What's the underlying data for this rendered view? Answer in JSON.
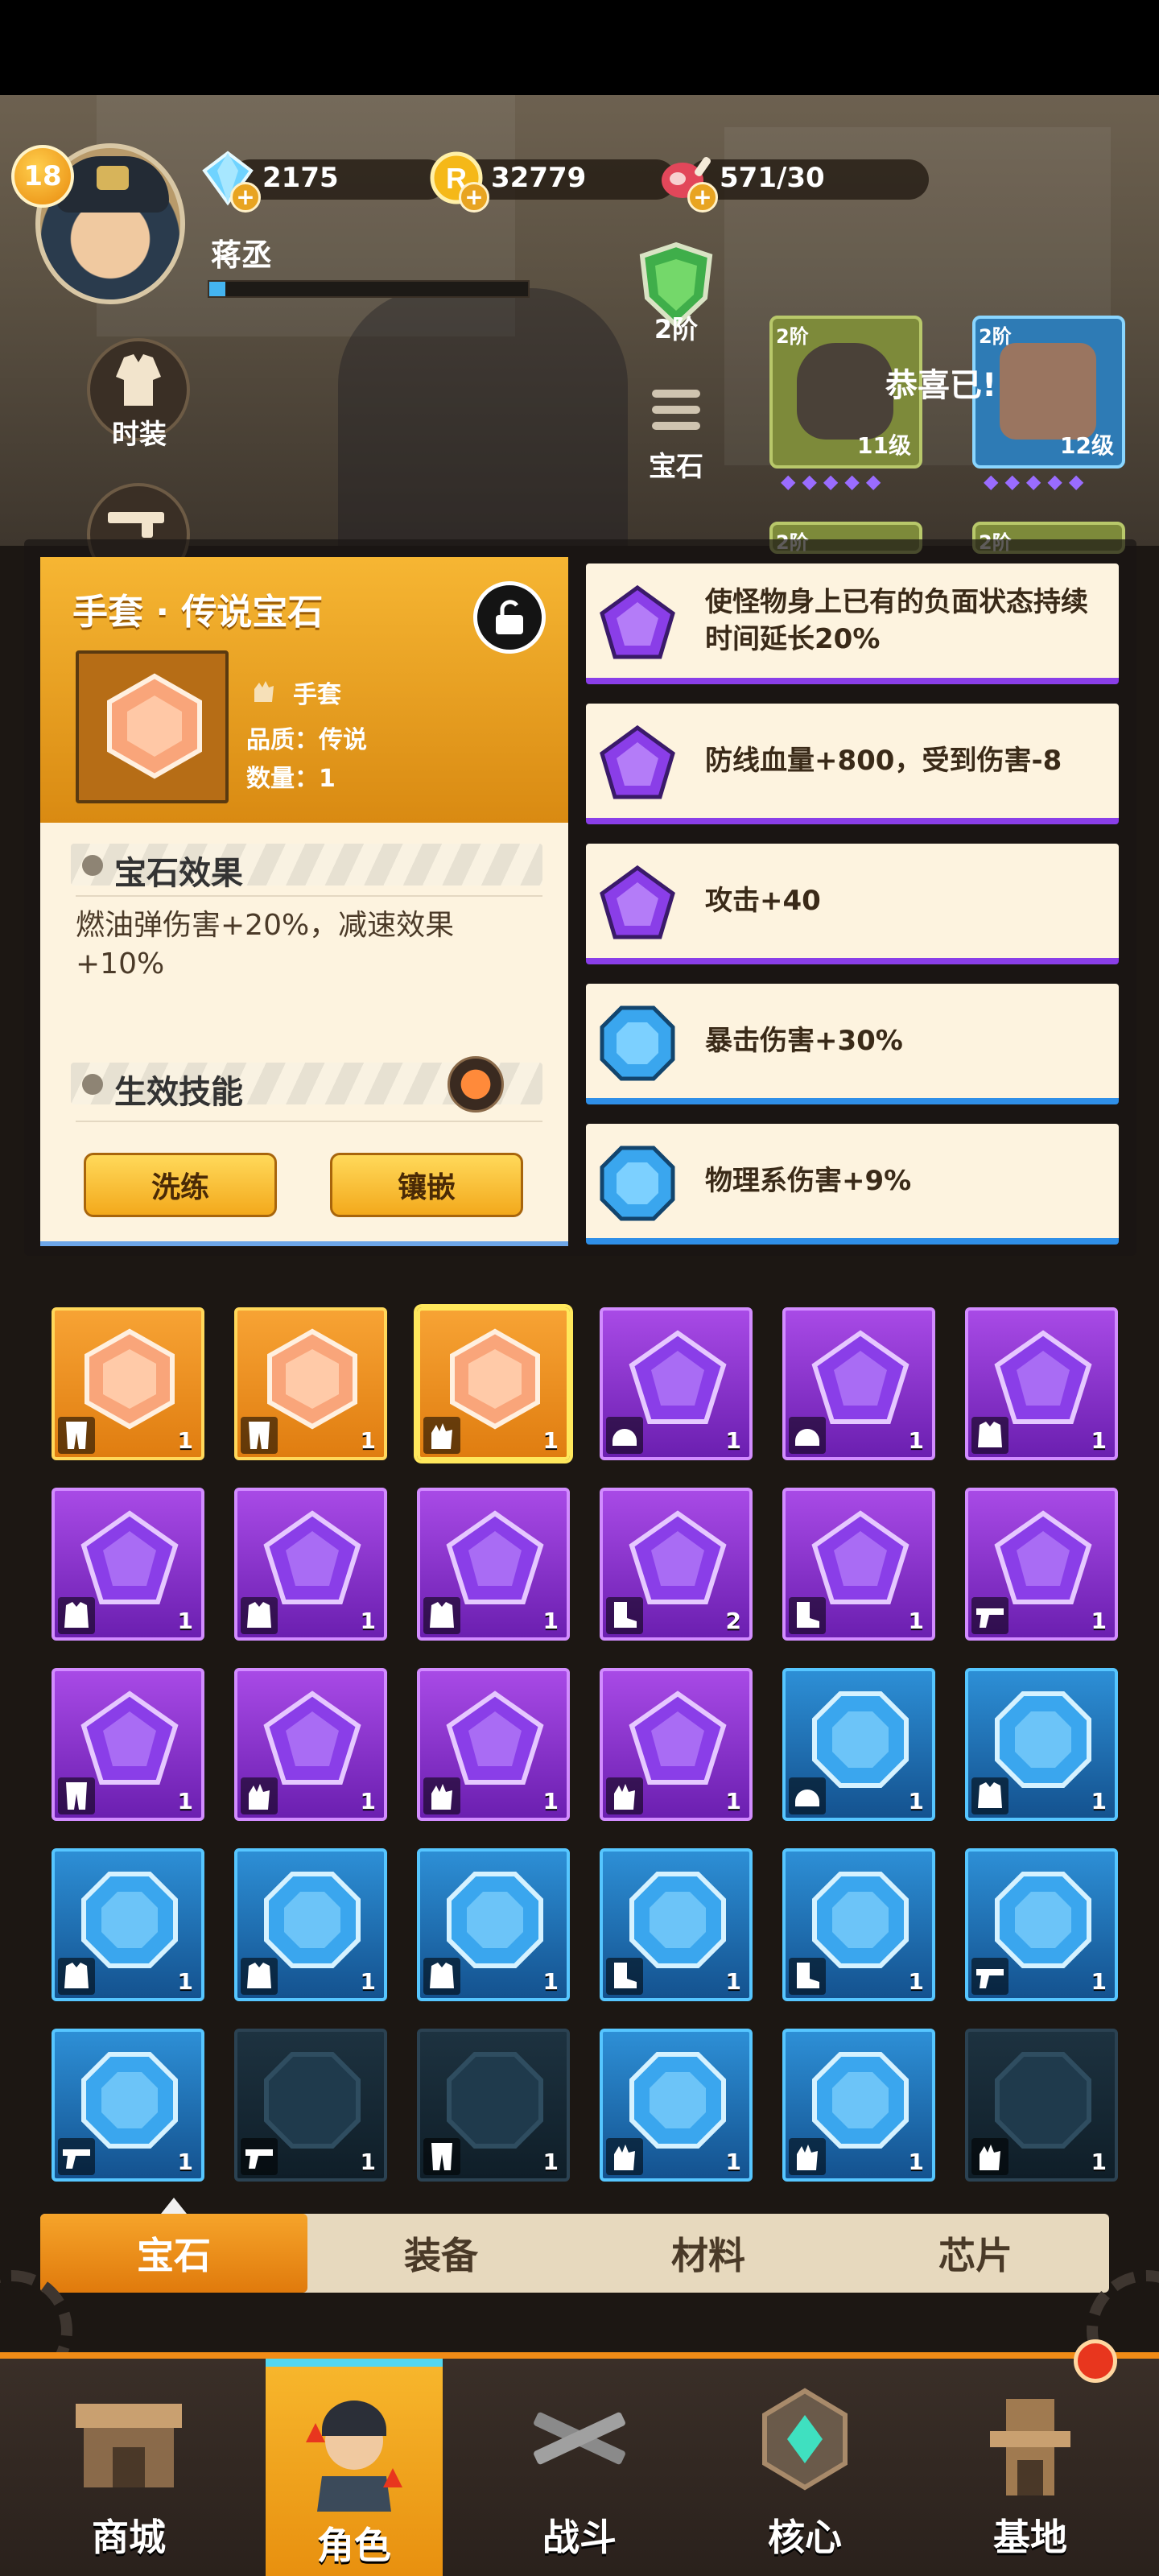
{
  "player": {
    "level": "18",
    "name": "蒋丞",
    "exp_fraction": 0.05
  },
  "resources": [
    {
      "name": "diamond",
      "value": "2175",
      "icon": "diamond-icon"
    },
    {
      "name": "coin",
      "value": "32779",
      "icon": "r-coin-icon"
    },
    {
      "name": "stamina",
      "value": "571/30",
      "icon": "meat-icon"
    }
  ],
  "side_buttons": {
    "fashion": "时装"
  },
  "equip_panel": {
    "tier_label": "2阶",
    "gem_label": "宝石",
    "congrats": "恭喜已!",
    "cards": [
      {
        "tier": "2阶",
        "level": "11级"
      },
      {
        "tier": "2阶",
        "level": "12级"
      },
      {
        "tier": "2阶"
      },
      {
        "tier": "2阶"
      }
    ]
  },
  "detail": {
    "title": "手套 · 传说宝石",
    "slot": "手套",
    "quality": "品质：传说",
    "quantity": "数量：1",
    "effect_header": "宝石效果",
    "effect_text": "燃油弹伤害+20%，减速效果+10%",
    "skill_header": "生效技能",
    "refine_button": "洗练",
    "inlay_button": "镶嵌"
  },
  "bonuses": [
    {
      "color": "purple",
      "text": "使怪物身上已有的负面状态持续时间延长20%"
    },
    {
      "color": "purple",
      "text": "防线血量+800，受到伤害-8"
    },
    {
      "color": "purple",
      "text": "攻击+40"
    },
    {
      "color": "blue",
      "text": "暴击伤害+30%"
    },
    {
      "color": "blue",
      "text": "物理系伤害+9%"
    }
  ],
  "gem_grid": [
    {
      "color": "orange",
      "slot": "pants",
      "qty": "1"
    },
    {
      "color": "orange",
      "slot": "pants",
      "qty": "1"
    },
    {
      "color": "orange",
      "slot": "glove",
      "qty": "1",
      "selected": true
    },
    {
      "color": "purple",
      "slot": "helmet",
      "qty": "1"
    },
    {
      "color": "purple",
      "slot": "helmet",
      "qty": "1"
    },
    {
      "color": "purple",
      "slot": "armor",
      "qty": "1"
    },
    {
      "color": "purple",
      "slot": "armor",
      "qty": "1"
    },
    {
      "color": "purple",
      "slot": "armor",
      "qty": "1"
    },
    {
      "color": "purple",
      "slot": "armor",
      "qty": "1"
    },
    {
      "color": "purple",
      "slot": "boot",
      "qty": "2"
    },
    {
      "color": "purple",
      "slot": "boot",
      "qty": "1"
    },
    {
      "color": "purple",
      "slot": "gun",
      "qty": "1"
    },
    {
      "color": "purple",
      "slot": "pants",
      "qty": "1"
    },
    {
      "color": "purple",
      "slot": "glove",
      "qty": "1"
    },
    {
      "color": "purple",
      "slot": "glove",
      "qty": "1"
    },
    {
      "color": "purple",
      "slot": "glove",
      "qty": "1"
    },
    {
      "color": "blue",
      "slot": "helmet",
      "qty": "1"
    },
    {
      "color": "blue",
      "slot": "armor",
      "qty": "1"
    },
    {
      "color": "blue",
      "slot": "armor",
      "qty": "1"
    },
    {
      "color": "blue",
      "slot": "armor",
      "qty": "1"
    },
    {
      "color": "blue",
      "slot": "armor",
      "qty": "1"
    },
    {
      "color": "blue",
      "slot": "boot",
      "qty": "1"
    },
    {
      "color": "blue",
      "slot": "boot",
      "qty": "1"
    },
    {
      "color": "blue",
      "slot": "gun",
      "qty": "1"
    },
    {
      "color": "blue",
      "slot": "gun",
      "qty": "1"
    },
    {
      "color": "dark",
      "slot": "gun",
      "qty": "1"
    },
    {
      "color": "dark",
      "slot": "pants",
      "qty": "1"
    },
    {
      "color": "blue",
      "slot": "glove",
      "qty": "1"
    },
    {
      "color": "blue",
      "slot": "glove",
      "qty": "1"
    },
    {
      "color": "dark",
      "slot": "glove",
      "qty": "1"
    }
  ],
  "tabs": [
    {
      "label": "宝石",
      "active": true
    },
    {
      "label": "装备"
    },
    {
      "label": "材料"
    },
    {
      "label": "芯片"
    }
  ],
  "nav": [
    {
      "label": "商城",
      "icon": "shop-icon"
    },
    {
      "label": "角色",
      "icon": "character-icon",
      "active": true
    },
    {
      "label": "战斗",
      "icon": "battle-icon"
    },
    {
      "label": "核心",
      "icon": "core-icon"
    },
    {
      "label": "基地",
      "icon": "base-icon"
    }
  ],
  "colors": {
    "orange_gem": "#f7a334",
    "purple_gem": "#8a3ee8",
    "blue_gem": "#2f8fe8",
    "accent": "#f08b16"
  }
}
